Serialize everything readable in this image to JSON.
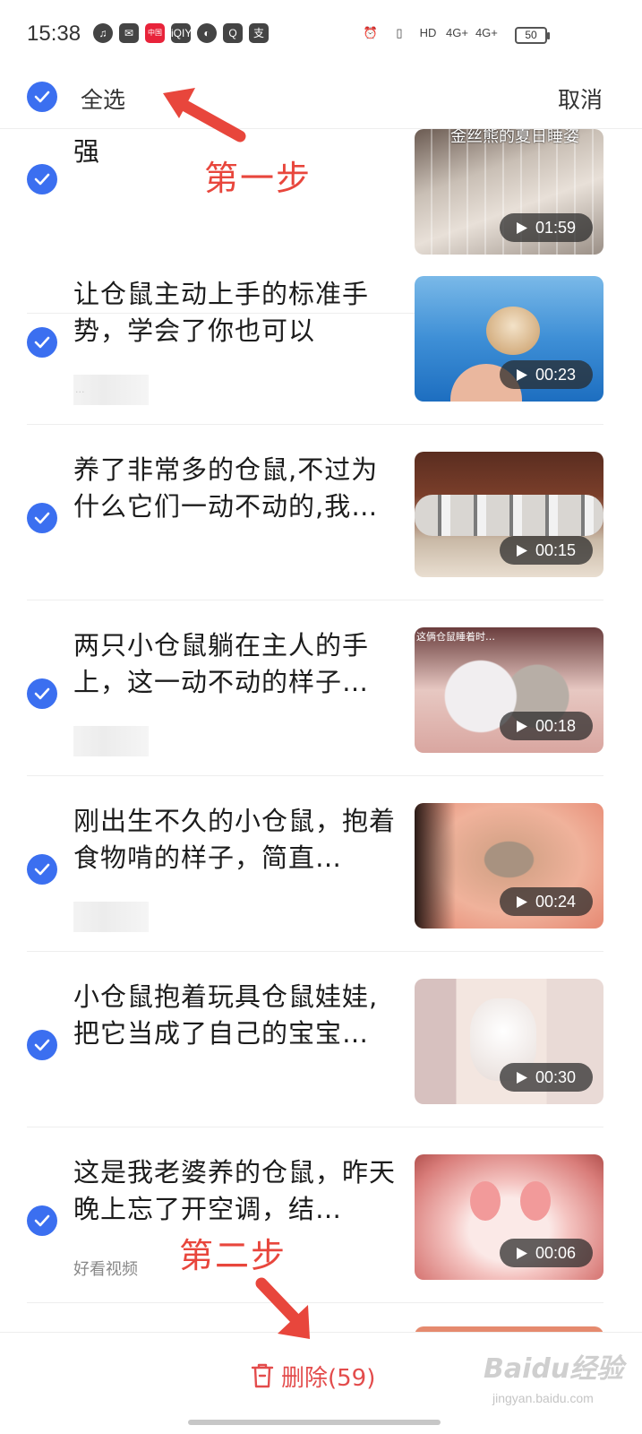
{
  "status_bar": {
    "time": "15:38",
    "app_icons": [
      "music-icon",
      "wechat-icon",
      "mobile-app-icon",
      "iqiyi-icon",
      "browser-icon",
      "search-app-icon",
      "alipay-icon"
    ],
    "app_icon_text": [
      "♫",
      "✉",
      "中国移动",
      "iQIY",
      "◐",
      "Q",
      "支"
    ],
    "network": [
      "⏰",
      "▯",
      "HD",
      "4G+",
      "4G+"
    ],
    "battery": "50"
  },
  "header": {
    "select_all_label": "全选",
    "cancel_label": "取消"
  },
  "items": [
    {
      "title": "强",
      "duration": "01:59",
      "source": "",
      "thumb_caption": "金丝熊的夏日睡姿"
    },
    {
      "title": "让仓鼠主动上手的标准手势，学会了你也可以",
      "duration": "00:23",
      "source": "..."
    },
    {
      "title": "养了非常多的仓鼠,不过为什么它们一动不动的,我…",
      "duration": "00:15",
      "source": ""
    },
    {
      "title": "两只小仓鼠躺在主人的手上，这一动不动的样子…",
      "duration": "00:18",
      "source": "",
      "thumb_caption": "这俩仓鼠睡着时…"
    },
    {
      "title": "刚出生不久的小仓鼠，抱着食物啃的样子，简直…",
      "duration": "00:24",
      "source": ""
    },
    {
      "title": "小仓鼠抱着玩具仓鼠娃娃,把它当成了自己的宝宝…",
      "duration": "00:30",
      "source": ""
    },
    {
      "title": "这是我老婆养的仓鼠，昨天晚上忘了开空调，结…",
      "duration": "00:06",
      "source": "好看视频"
    }
  ],
  "annotations": {
    "step1": "第一步",
    "step2": "第二步"
  },
  "bottom_bar": {
    "delete_label": "删除(59)"
  },
  "watermark": {
    "logo": "Baidu经验",
    "url": "jingyan.baidu.com"
  },
  "colors": {
    "accent": "#3b6ff0",
    "delete": "#e34c4c",
    "annotation": "#e8463c"
  }
}
